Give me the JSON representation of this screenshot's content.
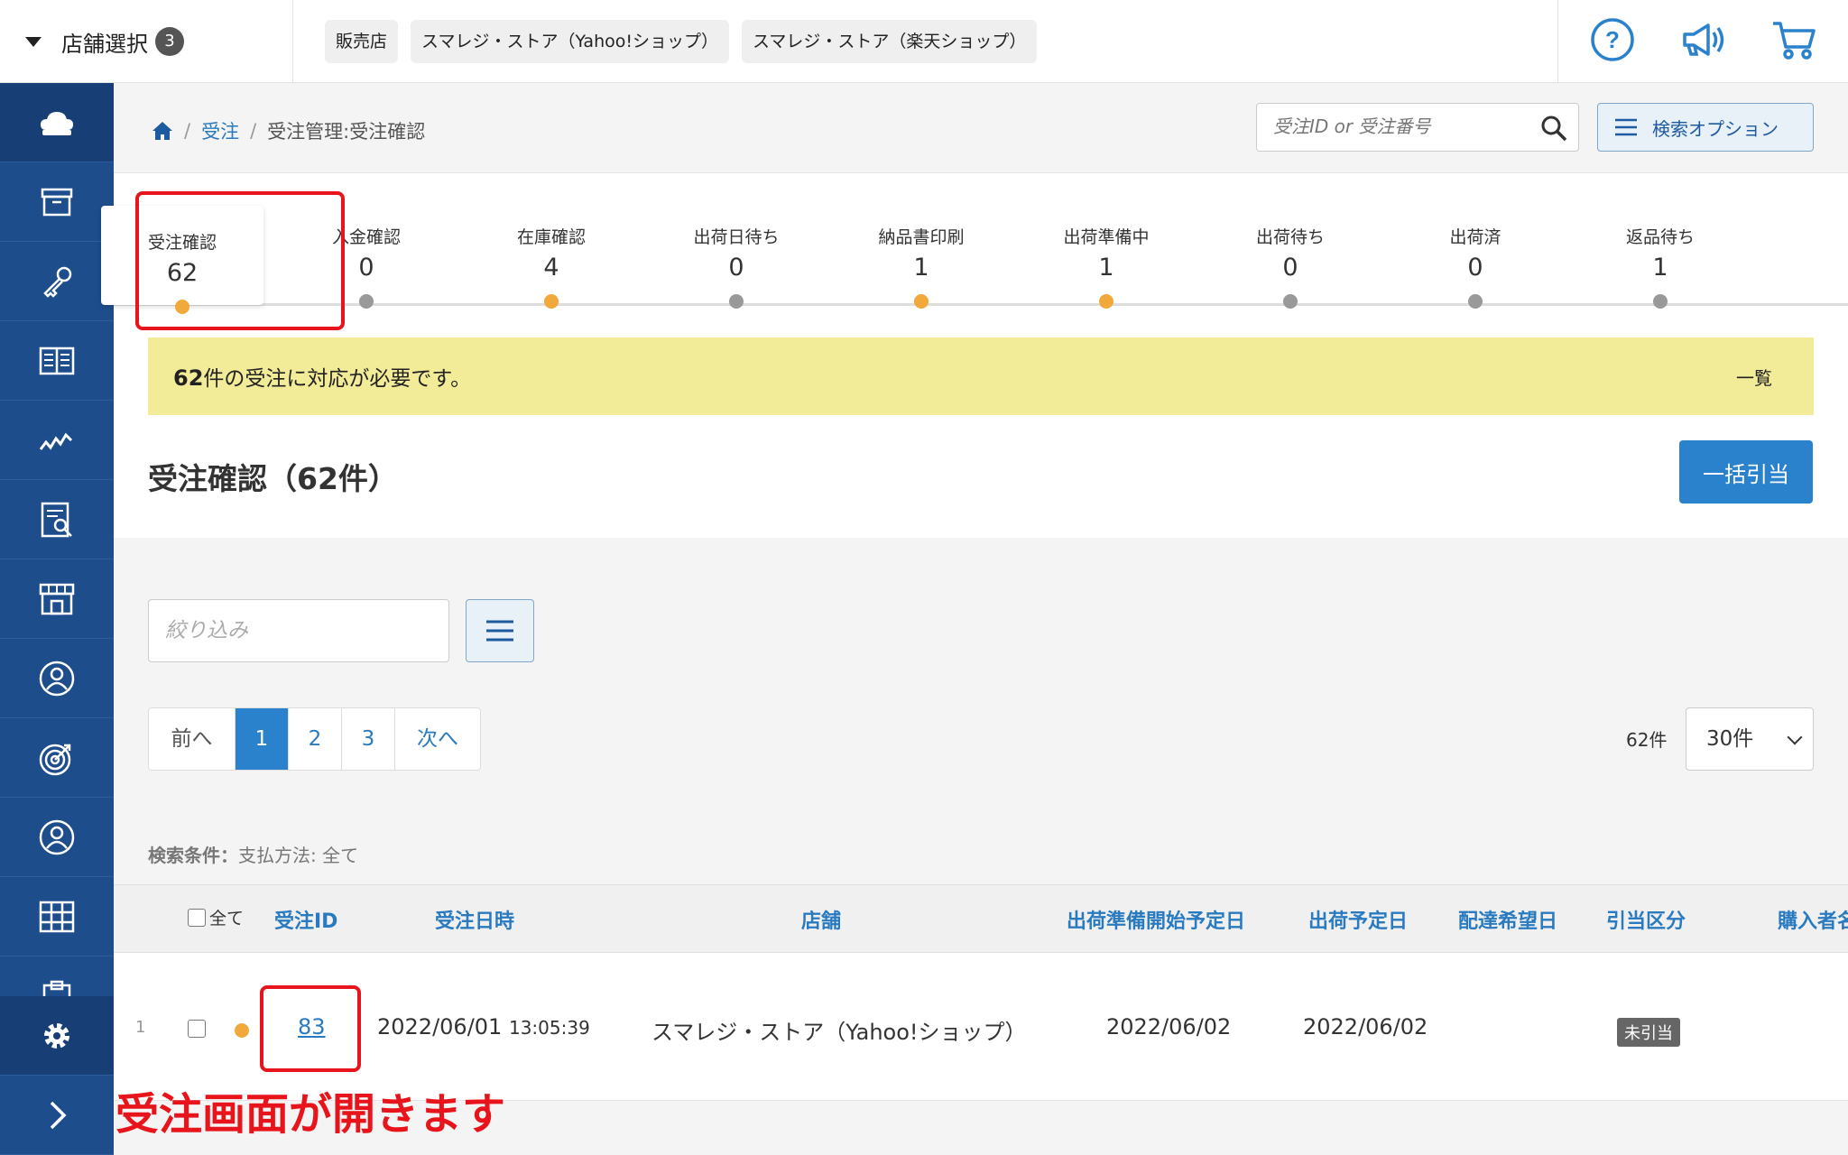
{
  "topbar": {
    "store_select_label": "店舗選択",
    "store_select_count": "3",
    "chips": [
      "販売店",
      "スマレジ・ストア（Yahoo!ショップ）",
      "スマレジ・ストア（楽天ショップ）"
    ],
    "icons": [
      "help-icon",
      "megaphone-icon",
      "cart-icon"
    ]
  },
  "sidebar": {
    "items": [
      "cloud-icon",
      "archive-icon",
      "key-icon",
      "book-icon",
      "chart-icon",
      "report-icon",
      "store-icon",
      "customer-icon",
      "target-icon",
      "user-icon",
      "grid-icon",
      "clipboard-icon"
    ],
    "bottom": [
      "gear-icon",
      "chevron-right-icon"
    ]
  },
  "breadcrumb": {
    "home": "home-icon",
    "level1": "受注",
    "current": "受注管理:受注確認"
  },
  "search": {
    "placeholder": "受注ID or 受注番号",
    "option_label": "検索オプション"
  },
  "steps": [
    {
      "label": "受注確認",
      "count": "62",
      "dot": "#f2a93b"
    },
    {
      "label": "入金確認",
      "count": "0",
      "dot": "#999999"
    },
    {
      "label": "在庫確認",
      "count": "4",
      "dot": "#f2a93b"
    },
    {
      "label": "出荷日待ち",
      "count": "0",
      "dot": "#999999"
    },
    {
      "label": "納品書印刷",
      "count": "1",
      "dot": "#f2a93b"
    },
    {
      "label": "出荷準備中",
      "count": "1",
      "dot": "#f2a93b"
    },
    {
      "label": "出荷待ち",
      "count": "0",
      "dot": "#999999"
    },
    {
      "label": "出荷済",
      "count": "0",
      "dot": "#999999"
    },
    {
      "label": "返品待ち",
      "count": "1",
      "dot": "#999999"
    }
  ],
  "notice": {
    "count": "62",
    "text": "件の受注に対応が必要です。",
    "link": "一覧"
  },
  "heading": "受注確認（62件）",
  "bulk_button": "一括引当",
  "filter": {
    "placeholder": "絞り込み"
  },
  "pager": {
    "prev": "前へ",
    "pages": [
      "1",
      "2",
      "3"
    ],
    "current": "1",
    "next": "次へ",
    "total": "62件",
    "per_page": "30件"
  },
  "conditions": {
    "label": "検索条件：",
    "value": "支払方法: 全て"
  },
  "table": {
    "select_all": "全て",
    "headers": [
      "受注ID",
      "受注日時",
      "店舗",
      "出荷準備開始予定日",
      "出荷予定日",
      "配達希望日",
      "引当区分",
      "購入者名"
    ],
    "rows": [
      {
        "num": "1",
        "status_color": "#f2a93b",
        "order_id": "83",
        "date": "2022/06/01",
        "time": "13:05:39",
        "store": "スマレジ・ストア（Yahoo!ショップ）",
        "prep_date": "2022/06/02",
        "ship_date": "2022/06/02",
        "delivery_date": "",
        "allocation": "未引当"
      }
    ]
  },
  "annotation": "受注画面が開きます",
  "colors": {
    "accent": "#2b82cc",
    "sidebar": "#1e4d8c",
    "highlight": "#e8141c",
    "notice_bg": "#f2eb97"
  }
}
